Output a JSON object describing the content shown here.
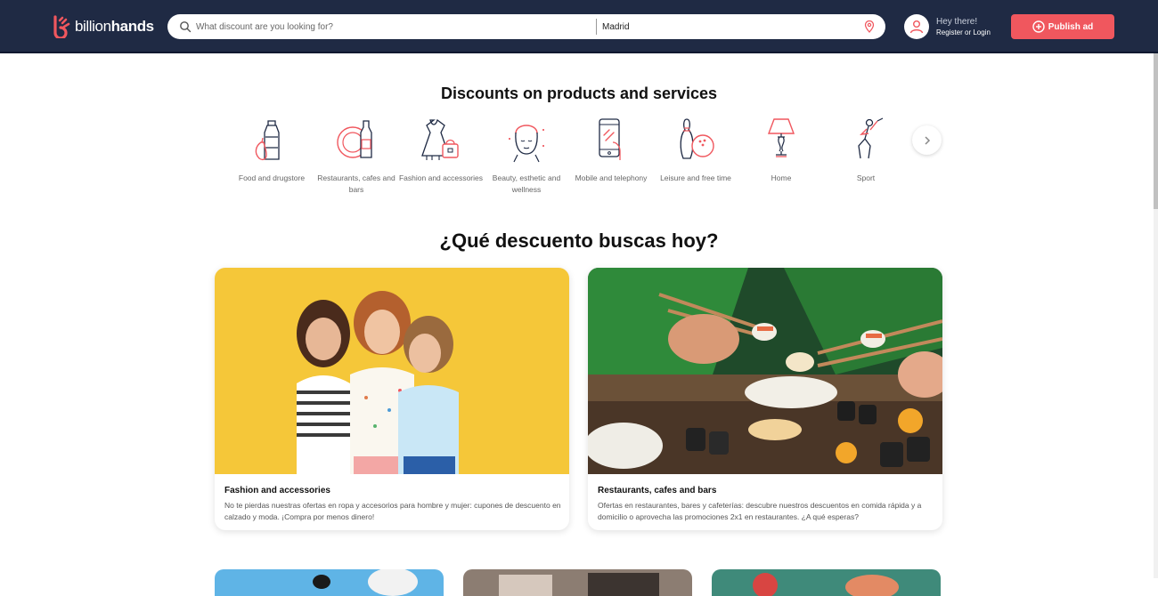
{
  "header": {
    "brand": {
      "light": "billion",
      "bold": "hands"
    },
    "search": {
      "placeholder": "What discount are you looking for?",
      "location": "Madrid"
    },
    "user": {
      "greeting": "Hey there!",
      "login": "Register or Login"
    },
    "publish_label": "Publish ad"
  },
  "sections": {
    "products_title": "Discounts on products and services",
    "search_title": "¿Qué descuento buscas hoy?"
  },
  "categories": [
    {
      "label": "Food and drugstore",
      "icon": "bottle-pear-icon"
    },
    {
      "label": "Restaurants, cafes and bars",
      "icon": "plate-wine-icon"
    },
    {
      "label": "Fashion and accessories",
      "icon": "dress-bag-icon"
    },
    {
      "label": "Beauty, esthetic and wellness",
      "icon": "face-mask-icon"
    },
    {
      "label": "Mobile and telephony",
      "icon": "smartphone-icon"
    },
    {
      "label": "Leisure and free time",
      "icon": "bowling-icon"
    },
    {
      "label": "Home",
      "icon": "lamp-icon"
    },
    {
      "label": "Sport",
      "icon": "golf-icon"
    }
  ],
  "cards": [
    {
      "title": "Fashion and accessories",
      "description": "No te pierdas nuestras ofertas en ropa y accesorios para hombre y mujer: cupones de descuento en calzado y moda. ¡Compra por menos dinero!"
    },
    {
      "title": "Restaurants, cafes and bars",
      "description": "Ofertas en restaurantes, bares y cafeterías: descubre nuestros descuentos en comida rápida y a domicilio o aprovecha las promociones 2x1 en restaurantes. ¿A qué esperas?"
    }
  ],
  "colors": {
    "header": "#1f2a44",
    "accent": "#f0575e",
    "icon_line": "#1f2a44"
  }
}
